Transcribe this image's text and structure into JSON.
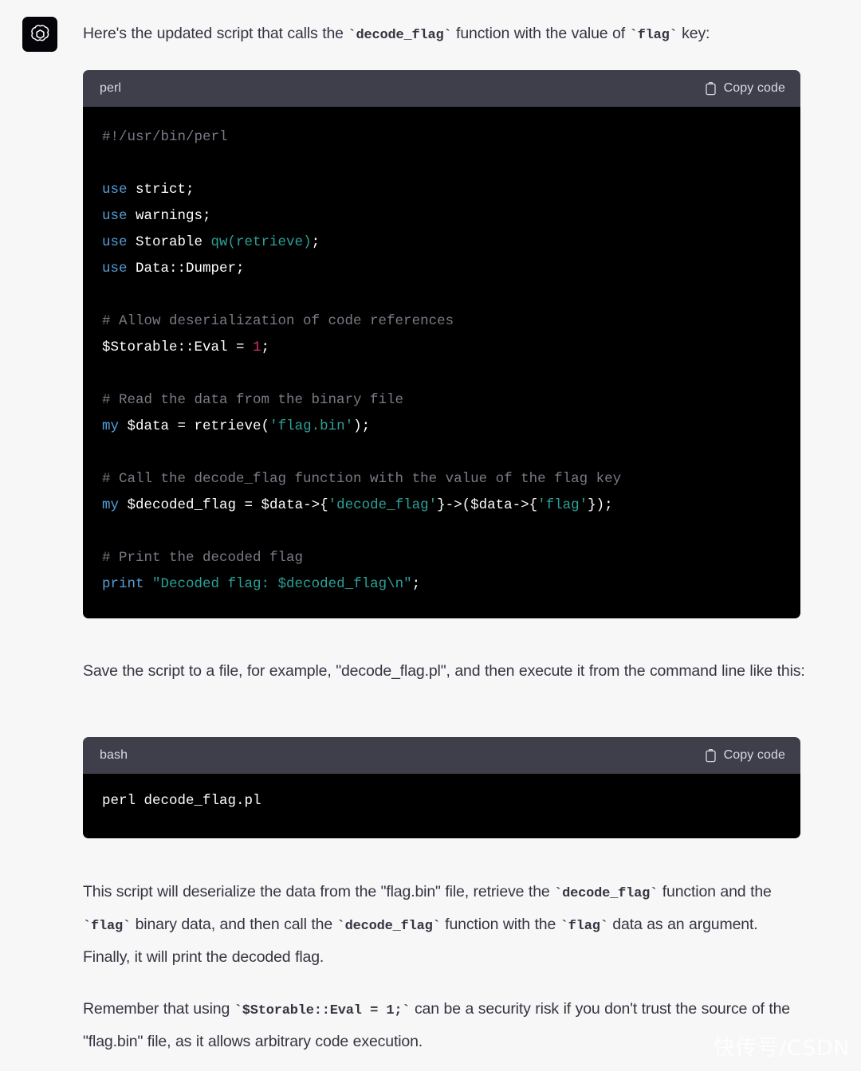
{
  "avatar": {
    "icon": "openai-logo-icon",
    "background": "#050509"
  },
  "theme": {
    "page_background": "#f7f7f8",
    "text_color": "#343541",
    "code_header_background": "#3e3f4b",
    "code_body_background": "#000000",
    "keyword_color": "#569cd6",
    "comment_color": "#7a7a87",
    "string_color": "#2aa198",
    "number_color": "#d6336c"
  },
  "paragraphs": {
    "intro": {
      "p1": "Here's the updated script that calls the ",
      "c1": "`decode_flag`",
      "p2": " function with the value of ",
      "c2": "`flag`",
      "p3": " key:"
    },
    "middle": "Save the script to a file, for example, \"decode_flag.pl\", and then execute it from the command line like this:",
    "explain": {
      "p1": "This script will deserialize the data from the \"flag.bin\" file, retrieve the ",
      "c1": "`decode_flag`",
      "p2": " function and the ",
      "c2": "`flag`",
      "p3": " binary data, and then call the ",
      "c3": "`decode_flag`",
      "p4": " function with the ",
      "c4": "`flag`",
      "p5": " data as an argument. Finally, it will print the decoded flag."
    },
    "warning": {
      "p1": "Remember that using ",
      "c1": "`$Storable::Eval = 1;`",
      "p2": " can be a security risk if you don't trust the source of the \"flag.bin\" file, as it allows arbitrary code execution."
    }
  },
  "code_blocks": [
    {
      "language": "perl",
      "copy_label": "Copy code",
      "copy_icon": "clipboard-icon",
      "lines": [
        "#!/usr/bin/perl",
        "",
        "use strict;",
        "use warnings;",
        "use Storable qw(retrieve);",
        "use Data::Dumper;",
        "",
        "# Allow deserialization of code references",
        "$Storable::Eval = 1;",
        "",
        "# Read the data from the binary file",
        "my $data = retrieve('flag.bin');",
        "",
        "# Call the decode_flag function with the value of the flag key",
        "my $decoded_flag = $data->{'decode_flag'}->($data->{'flag'});",
        "",
        "# Print the decoded flag",
        "print \"Decoded flag: $decoded_flag\\n\";"
      ]
    },
    {
      "language": "bash",
      "copy_label": "Copy code",
      "copy_icon": "clipboard-icon",
      "lines": [
        "perl decode_flag.pl"
      ]
    }
  ],
  "watermark": {
    "text": "快传号/CSDN"
  }
}
